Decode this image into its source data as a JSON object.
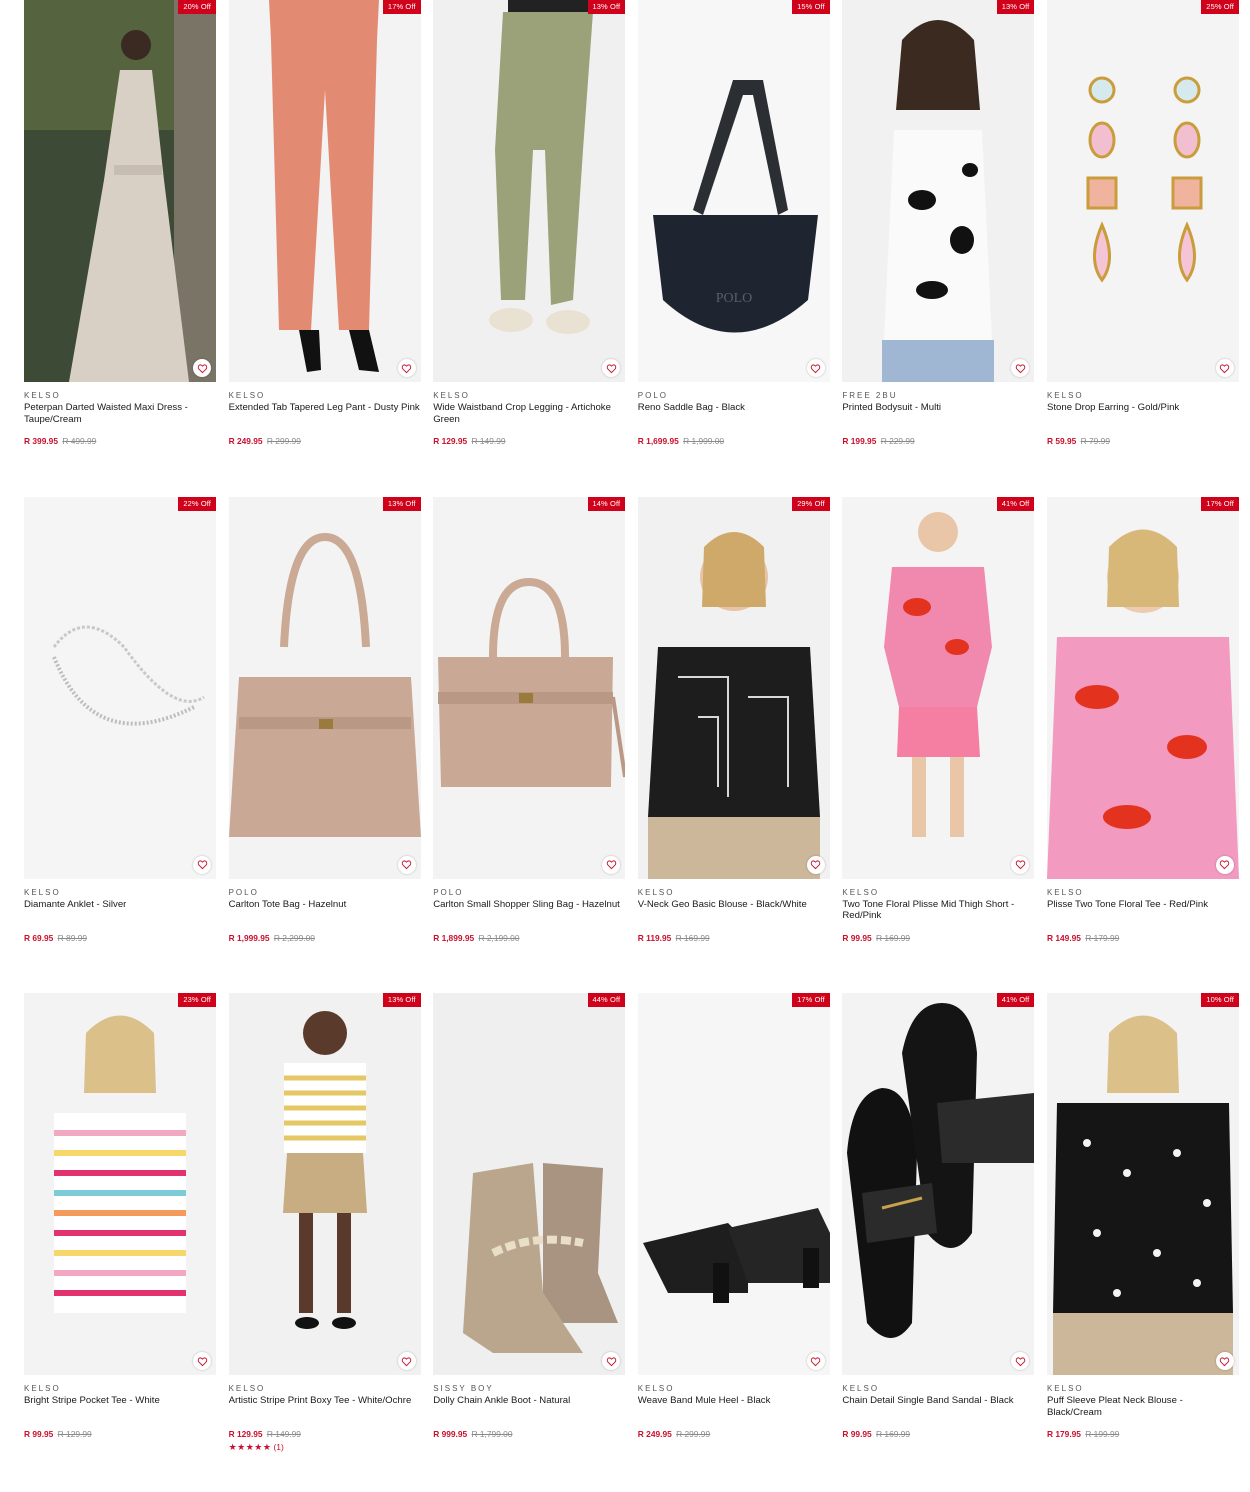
{
  "colors": {
    "accent": "#d0021b",
    "price": "#c8102e",
    "was_price": "#8a8a8a"
  },
  "products": [
    {
      "brand": "KELSO",
      "name": "Peterpan Darted Waisted Maxi Dress - Taupe/Cream",
      "price": "R 399.95",
      "was": "R 499.99",
      "badge": "20% Off",
      "image": "woman-maxi-dress"
    },
    {
      "brand": "KELSO",
      "name": "Extended Tab Tapered Leg Pant - Dusty Pink",
      "price": "R 249.95",
      "was": "R 299.99",
      "badge": "17% Off",
      "image": "pink-trousers"
    },
    {
      "brand": "KELSO",
      "name": "Wide Waistband Crop Legging - Artichoke Green",
      "price": "R 129.95",
      "was": "R 149.99",
      "badge": "13% Off",
      "image": "green-legging"
    },
    {
      "brand": "POLO",
      "name": "Reno Saddle Bag - Black",
      "price": "R 1,699.95",
      "was": "R 1,999.00",
      "badge": "15% Off",
      "image": "black-saddle-bag"
    },
    {
      "brand": "FREE 2BU",
      "name": "Printed Bodysuit - Multi",
      "price": "R 199.95",
      "was": "R 229.99",
      "badge": "13% Off",
      "image": "cow-print-bodysuit"
    },
    {
      "brand": "KELSO",
      "name": "Stone Drop Earring - Gold/Pink",
      "price": "R 59.95",
      "was": "R 79.99",
      "badge": "25% Off",
      "image": "pink-drop-earrings"
    },
    {
      "brand": "KELSO",
      "name": "Diamante Anklet - Silver",
      "price": "R 69.95",
      "was": "R 89.99",
      "badge": "22% Off",
      "image": "silver-anklet"
    },
    {
      "brand": "POLO",
      "name": "Carlton Tote Bag - Hazelnut",
      "price": "R 1,999.95",
      "was": "R 2,299.00",
      "badge": "13% Off",
      "image": "hazelnut-tote"
    },
    {
      "brand": "POLO",
      "name": "Carlton Small Shopper Sling Bag - Hazelnut",
      "price": "R 1,899.95",
      "was": "R 2,199.00",
      "badge": "14% Off",
      "image": "hazelnut-sling"
    },
    {
      "brand": "KELSO",
      "name": "V-Neck Geo Basic Blouse - Black/White",
      "price": "R 119.95",
      "was": "R 169.99",
      "badge": "29% Off",
      "image": "geo-blouse"
    },
    {
      "brand": "KELSO",
      "name": "Two Tone Floral Plisse Mid Thigh Short - Red/Pink",
      "price": "R 99.95",
      "was": "R 169.99",
      "badge": "41% Off",
      "image": "floral-set"
    },
    {
      "brand": "KELSO",
      "name": "Plisse Two Tone Floral Tee - Red/Pink",
      "price": "R 149.95",
      "was": "R 179.99",
      "badge": "17% Off",
      "image": "floral-tee"
    },
    {
      "brand": "KELSO",
      "name": "Bright Stripe Pocket Tee - White",
      "price": "R 99.95",
      "was": "R 129.99",
      "badge": "23% Off",
      "image": "stripe-tee"
    },
    {
      "brand": "KELSO",
      "name": "Artistic Stripe Print Boxy Tee - White/Ochre",
      "price": "R 129.95",
      "was": "R 149.99",
      "badge": "13% Off",
      "image": "ochre-stripe-tee",
      "rating": "★★★★★",
      "rating_count": "(1)"
    },
    {
      "brand": "SISSY BOY",
      "name": "Dolly Chain Ankle Boot - Natural",
      "price": "R 999.95",
      "was": "R 1,799.00",
      "badge": "44% Off",
      "image": "snake-boots"
    },
    {
      "brand": "KELSO",
      "name": "Weave Band Mule Heel - Black",
      "price": "R 249.95",
      "was": "R 299.99",
      "badge": "17% Off",
      "image": "black-mules"
    },
    {
      "brand": "KELSO",
      "name": "Chain Detail Single Band Sandal - Black",
      "price": "R 99.95",
      "was": "R 169.99",
      "badge": "41% Off",
      "image": "black-sandals"
    },
    {
      "brand": "KELSO",
      "name": "Puff Sleeve Pleat Neck Blouse - Black/Cream",
      "price": "R 179.95",
      "was": "R 199.99",
      "badge": "10% Off",
      "image": "floral-black-blouse"
    }
  ]
}
